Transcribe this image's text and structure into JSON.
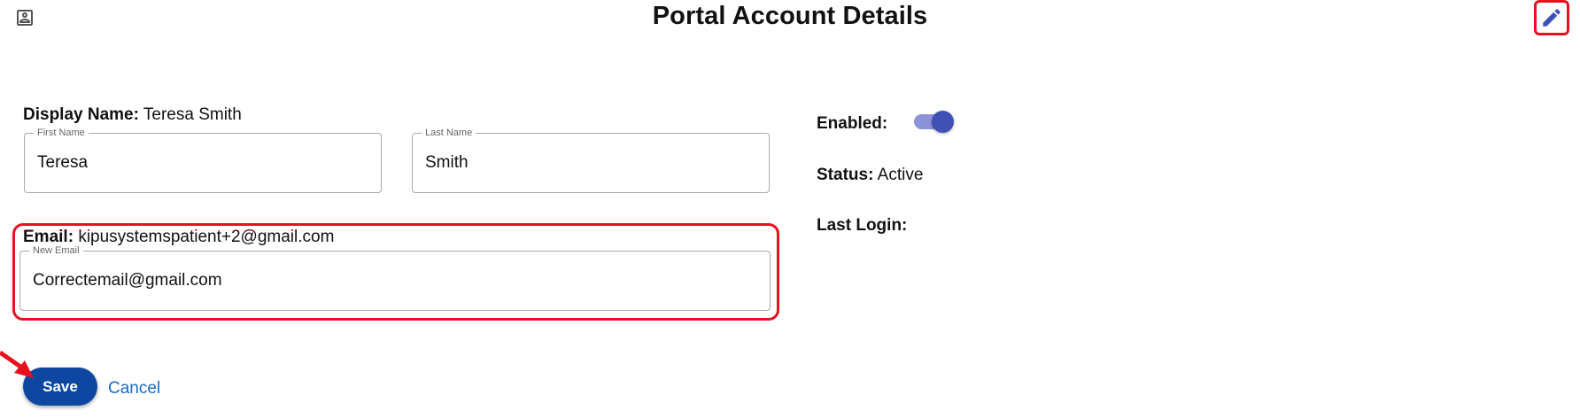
{
  "header": {
    "title": "Portal Account Details",
    "profile_icon": "account-box-icon",
    "edit_icon": "pencil-icon"
  },
  "account": {
    "display_name_label": "Display Name:",
    "display_name_value": "Teresa Smith",
    "first_name": {
      "label": "First Name",
      "value": "Teresa"
    },
    "last_name": {
      "label": "Last Name",
      "value": "Smith"
    },
    "email_label": "Email:",
    "email_value": "kipusystemspatient+2@gmail.com",
    "new_email": {
      "label": "New Email",
      "value": "Correctemail@gmail.com"
    }
  },
  "actions": {
    "save_label": "Save",
    "cancel_label": "Cancel"
  },
  "status_panel": {
    "enabled_label": "Enabled:",
    "enabled": true,
    "status_label": "Status:",
    "status_value": "Active",
    "last_login_label": "Last Login:",
    "last_login_value": ""
  },
  "colors": {
    "highlight": "#e8101e",
    "primary": "#0d47a1",
    "accent": "#3f51b5",
    "link": "#1a6bc4"
  }
}
